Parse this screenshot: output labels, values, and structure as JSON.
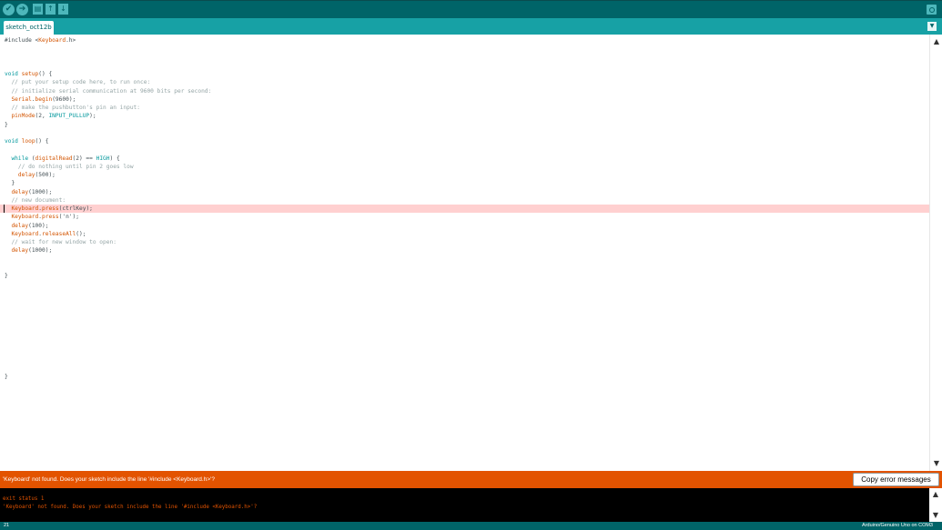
{
  "toolbar": {
    "verify_icon": "✔",
    "upload_icon": "➔",
    "new_icon": "▤",
    "open_icon": "↑",
    "save_icon": "↓"
  },
  "tab": {
    "label": "sketch_oct12b"
  },
  "editor": {
    "lines": [
      "#include <Keyboard.h>",
      "",
      "",
      "",
      "void setup() {",
      "  // put your setup code here, to run once:",
      "  // initialize serial communication at 9600 bits per second:",
      "  Serial.begin(9600);",
      "  // make the pushbutton's pin an input:",
      "  pinMode(2, INPUT_PULLUP);",
      "}",
      "",
      "void loop() {",
      "",
      "  while (digitalRead(2) == HIGH) {",
      "    // do nothing until pin 2 goes low",
      "    delay(500);",
      "  }",
      "  delay(1000);",
      "  // new document:",
      "  Keyboard.press(ctrlKey);",
      "  Keyboard.press('n');",
      "  delay(100);",
      "  Keyboard.releaseAll();",
      "  // wait for new window to open:",
      "  delay(1000);",
      "",
      "",
      "}",
      "",
      "",
      "",
      "",
      "",
      "",
      "",
      "",
      "",
      "",
      "",
      "}"
    ],
    "highlighted_line": 21
  },
  "error_bar": {
    "message": "'Keyboard' not found. Does your sketch include the line '#include <Keyboard.h>'?",
    "copy_button": "Copy error messages"
  },
  "console": {
    "lines": [
      "exit status 1",
      "'Keyboard' not found. Does your sketch include the line '#include <Keyboard.h>'?"
    ]
  },
  "status": {
    "line_number": "21",
    "board": "Arduino/Genuino Uno on COM3"
  }
}
